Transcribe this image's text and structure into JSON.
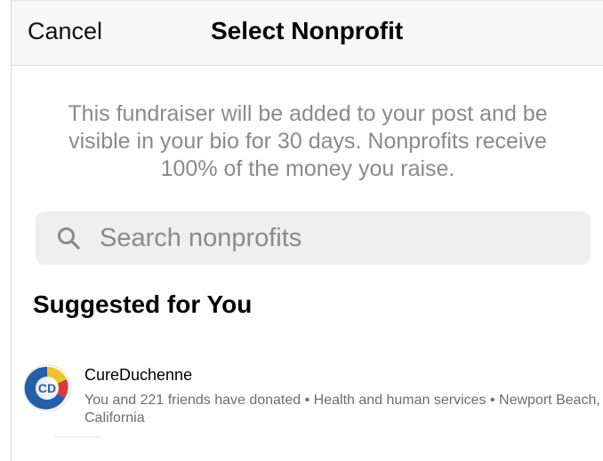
{
  "header": {
    "cancel_label": "Cancel",
    "title": "Select Nonprofit"
  },
  "intro": {
    "text": "This fundraiser will be added to your post and be visible in your bio for 30 days. Nonprofits receive 100% of the money you raise."
  },
  "search": {
    "icon": "search-icon",
    "placeholder": "Search nonprofits",
    "value": ""
  },
  "suggested": {
    "heading": "Suggested for You",
    "items": [
      {
        "name": "CureDuchenne",
        "avatar_text": "CD",
        "meta": "You and 221 friends have donated • Health and human services • Newport Beach, California"
      }
    ]
  },
  "colors": {
    "header_bg": "#f7f7f7",
    "secondary_text": "#8a8a8e",
    "search_bg": "#efeff0",
    "avatar_blue": "#2460a7",
    "avatar_yellow": "#f2c12e",
    "avatar_red": "#d83a3a"
  }
}
